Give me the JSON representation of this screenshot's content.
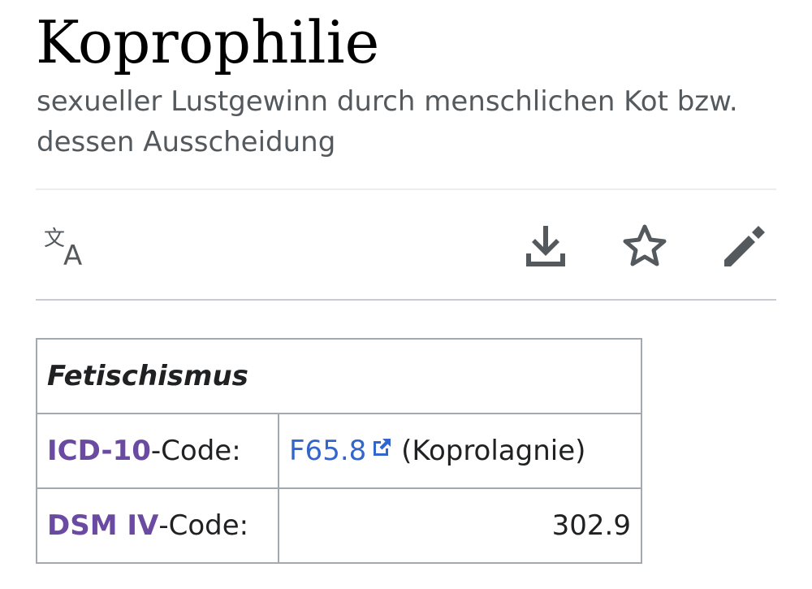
{
  "article": {
    "title": "Koprophilie",
    "description": "sexueller Lustgewinn durch menschlichen Kot bzw. dessen Ausscheidung"
  },
  "toolbar": {
    "icons": [
      "translate-icon",
      "download-icon",
      "star-icon",
      "edit-icon"
    ],
    "icon_color": "#54595d"
  },
  "infobox": {
    "heading": "Fetischismus",
    "rows": [
      {
        "label_link": "ICD-10",
        "label_suffix": "-Code:",
        "value_link": "F65.8",
        "value_text": "(Koprolagnie)"
      },
      {
        "label_link": "DSM IV",
        "label_suffix": "-Code:",
        "value_text": "302.9"
      }
    ],
    "link_color": "#6b4ba1",
    "external_link_color": "#3366cc",
    "border_color": "#a2a9b1"
  }
}
